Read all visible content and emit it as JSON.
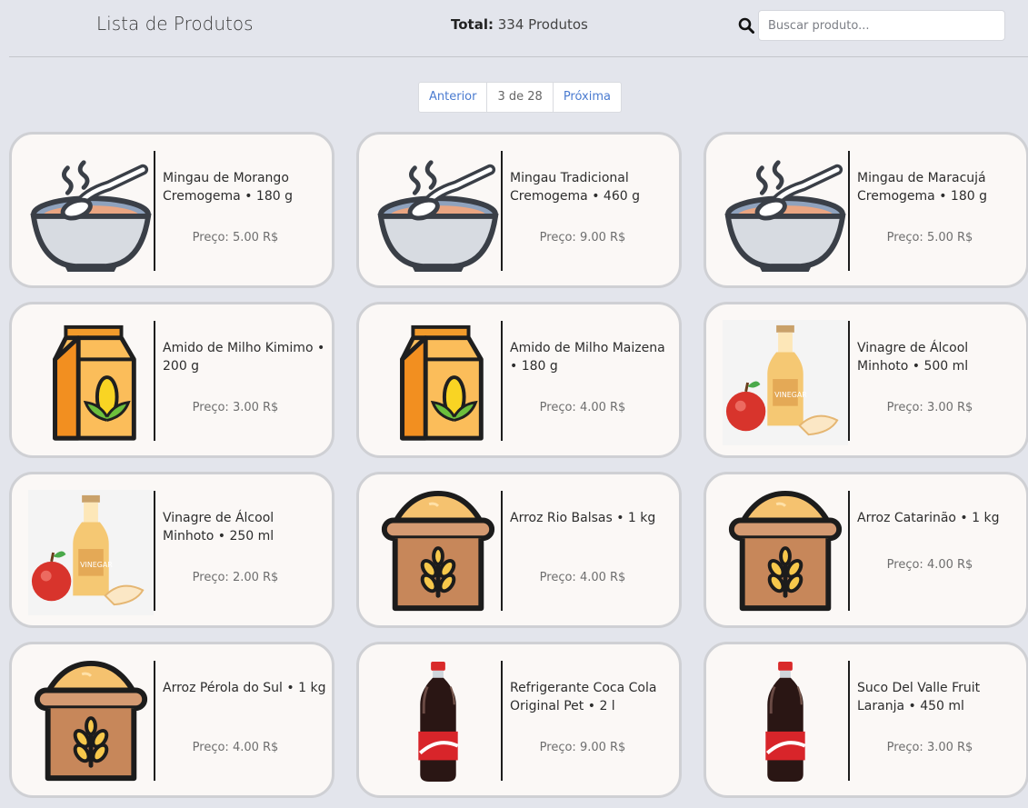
{
  "header": {
    "title": "Lista de Produtos",
    "total_label": "Total:",
    "total_value": "334 Produtos",
    "search_placeholder": "Buscar produto...",
    "search_icon": "search-icon"
  },
  "pagination": {
    "prev": "Anterior",
    "current": "3 de 28",
    "next": "Próxima"
  },
  "products": [
    {
      "name": "Mingau de Morango Cremogema • 180 g",
      "price": "Preço: 5.00 R$",
      "icon": "porridge-bowl-icon"
    },
    {
      "name": "Mingau Tradicional Cremogema • 460 g",
      "price": "Preço: 9.00 R$",
      "icon": "porridge-bowl-icon"
    },
    {
      "name": "Mingau de Maracujá Cremogema • 180 g",
      "price": "Preço: 5.00 R$",
      "icon": "porridge-bowl-icon"
    },
    {
      "name": "Amido de Milho Kimimo • 200 g",
      "price": "Preço: 3.00 R$",
      "icon": "corn-starch-box-icon"
    },
    {
      "name": "Amido de Milho Maizena • 180 g",
      "price": "Preço: 4.00 R$",
      "icon": "corn-starch-box-icon"
    },
    {
      "name": "Vinagre de Álcool Minhoto • 500 ml",
      "price": "Preço: 3.00 R$",
      "icon": "vinegar-bottle-icon"
    },
    {
      "name": "Vinagre de Álcool Minhoto • 250 ml",
      "price": "Preço: 2.00 R$",
      "icon": "vinegar-bottle-icon"
    },
    {
      "name": "Arroz Rio Balsas • 1 kg",
      "price": "Preço: 4.00 R$",
      "icon": "rice-sack-icon"
    },
    {
      "name": "Arroz Catarinão • 1 kg",
      "price": "Preço: 4.00 R$",
      "icon": "rice-sack-icon"
    },
    {
      "name": "Arroz Pérola do Sul • 1 kg",
      "price": "Preço: 4.00 R$",
      "icon": "rice-sack-icon"
    },
    {
      "name": "Refrigerante Coca Cola Original Pet • 2 l",
      "price": "Preço: 9.00 R$",
      "icon": "soda-bottle-icon"
    },
    {
      "name": "Suco Del Valle Fruit Laranja • 450 ml",
      "price": "Preço: 3.00 R$",
      "icon": "soda-bottle-icon"
    }
  ],
  "colors": {
    "background": "#e3e5ec",
    "card": "#fbf8f6",
    "link": "#4a7bd0"
  }
}
